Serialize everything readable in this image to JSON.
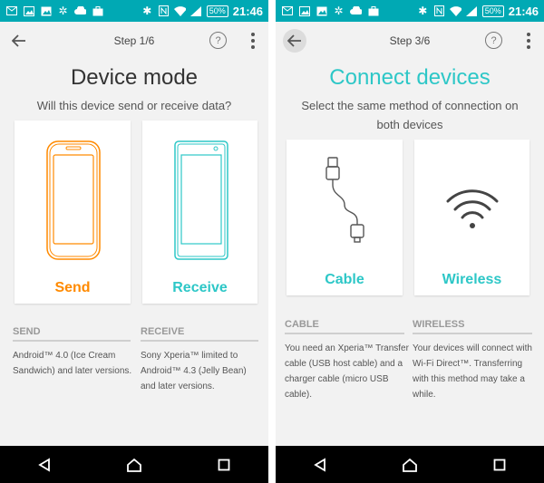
{
  "status_bar": {
    "battery": "50%",
    "time": "21:46"
  },
  "step1": {
    "step_label": "Step 1/6",
    "help_label": "?",
    "title": "Device mode",
    "subtitle": "Will this device send or receive data?",
    "cards": [
      {
        "label": "Send",
        "color": "#ff8a00"
      },
      {
        "label": "Receive",
        "color": "#2dc7c7"
      }
    ],
    "info": [
      {
        "heading": "SEND",
        "text": "Android™ 4.0 (Ice Cream Sandwich) and later versions."
      },
      {
        "heading": "RECEIVE",
        "text": "Sony Xperia™ limited to Android™ 4.3 (Jelly Bean) and later versions."
      }
    ]
  },
  "step3": {
    "step_label": "Step 3/6",
    "help_label": "?",
    "title": "Connect devices",
    "subtitle": "Select the same method of connection on both devices",
    "cards": [
      {
        "label": "Cable",
        "color": "#2dc7c7"
      },
      {
        "label": "Wireless",
        "color": "#2dc7c7"
      }
    ],
    "info": [
      {
        "heading": "CABLE",
        "text": "You need an Xperia™ Transfer cable (USB host cable) and a charger cable (micro USB cable)."
      },
      {
        "heading": "WIRELESS",
        "text": "Your devices will connect with Wi-Fi Direct™. Transferring with this method may take a while."
      }
    ]
  },
  "colors": {
    "accent_teal": "#2dc7c7",
    "accent_orange": "#ff8a00",
    "status_bar": "#00a9b4"
  }
}
